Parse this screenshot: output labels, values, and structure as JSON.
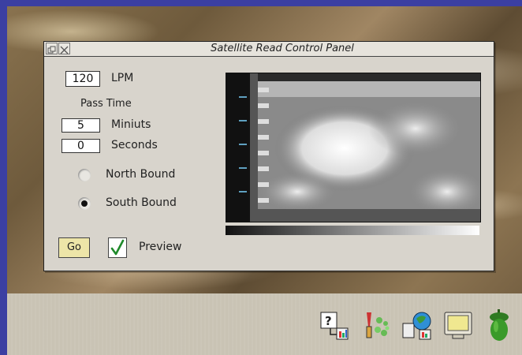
{
  "window": {
    "title": "Satellite Read Control Panel"
  },
  "lpm": {
    "value": "120",
    "unit": "LPM"
  },
  "pass_time": {
    "heading": "Pass Time",
    "minutes_value": "5",
    "minutes_label": "Miniuts",
    "seconds_value": "0",
    "seconds_label": "Seconds"
  },
  "direction": {
    "north_label": "North Bound",
    "south_label": "South Bound",
    "selected": "south"
  },
  "actions": {
    "go_label": "Go",
    "preview_label": "Preview",
    "preview_checked": true
  },
  "iconbar": {
    "icons": [
      "help-icon",
      "paint-icon",
      "network-icon",
      "monitor-icon",
      "acorn-icon"
    ]
  }
}
